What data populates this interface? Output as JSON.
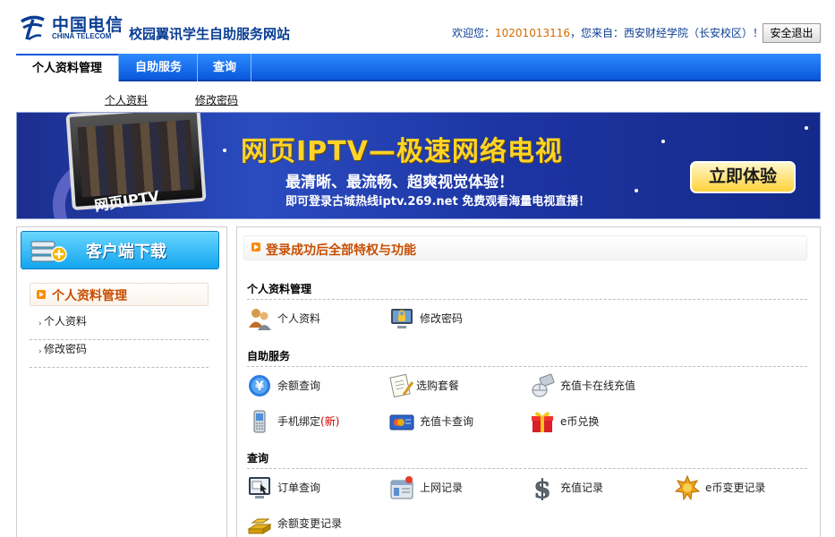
{
  "header": {
    "logo_cn": "中国电信",
    "logo_en": "CHINA TELECOM",
    "site_title": "校园翼讯学生自助服务网站",
    "welcome_prefix": "欢迎您：",
    "account": "10201013116",
    "welcome_mid": "，您来自：西安财经学院（长安校区）！",
    "logout_label": "安全退出"
  },
  "nav": {
    "tabs": [
      {
        "label": "个人资料管理",
        "active": true
      },
      {
        "label": "自助服务",
        "active": false
      },
      {
        "label": "查询",
        "active": false
      }
    ],
    "sub": [
      "个人资料",
      "修改密码"
    ]
  },
  "banner": {
    "tv_label": "网页IPTV",
    "headline": "网页IPTV—极速网络电视",
    "sub1": "最清晰、最流畅、超爽视觉体验！",
    "sub2": "即可登录古城热线iptv.269.net  免费观看海量电视直播！",
    "cta": "立即体验"
  },
  "left": {
    "download_label": "客户端下载",
    "section_title": "个人资料管理",
    "links": [
      "个人资料",
      "修改密码"
    ]
  },
  "right": {
    "title": "登录成功后全部特权与功能",
    "sections": [
      {
        "title": "个人资料管理",
        "items": [
          {
            "icon": "users-icon",
            "label": "个人资料"
          },
          {
            "icon": "monitor-lock-icon",
            "label": "修改密码"
          }
        ]
      },
      {
        "title": "自助服务",
        "items": [
          {
            "icon": "yuan-icon",
            "label": "余额查询"
          },
          {
            "icon": "notepad-pen-icon",
            "label": "选购套餐"
          },
          {
            "icon": "mouse-card-icon",
            "label": "充值卡在线充值"
          },
          {
            "icon": "phone-icon",
            "label": "手机绑定",
            "badge": "(新)"
          },
          {
            "icon": "card-icon",
            "label": "充值卡查询"
          },
          {
            "icon": "gift-icon",
            "label": "e币兑换"
          }
        ]
      },
      {
        "title": "查询",
        "items": [
          {
            "icon": "order-monitor-icon",
            "label": "订单查询"
          },
          {
            "icon": "browser-record-icon",
            "label": "上网记录"
          },
          {
            "icon": "dollar-icon",
            "label": "充值记录"
          },
          {
            "icon": "coin-star-icon",
            "label": "e币变更记录"
          },
          {
            "icon": "gold-stack-icon",
            "label": "余额变更记录"
          }
        ]
      }
    ]
  },
  "colors": {
    "nav_blue": "#0a58dc",
    "title_blue": "#0b3e94",
    "accent_orange": "#c84d00",
    "account_orange": "#d56a00",
    "badge_red": "#d40000"
  }
}
